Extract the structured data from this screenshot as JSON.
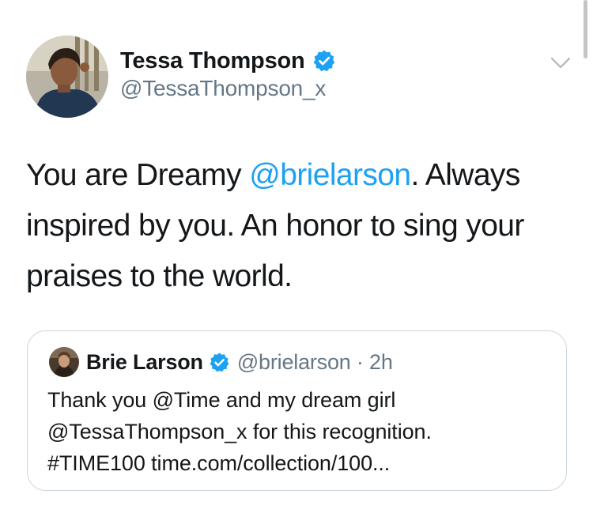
{
  "tweet": {
    "author": {
      "display_name": "Tessa Thompson",
      "handle": "@TessaThompson_x",
      "verified": true,
      "avatar_icon": "profile-photo"
    },
    "menu_icon": "chevron-down-icon",
    "text": {
      "part1": "You are Dreamy ",
      "mention": "@brielarson",
      "part2": ". Always inspired by you. An honor to sing your praises to the world."
    },
    "quoted_tweet": {
      "display_name": "Brie Larson",
      "verified": true,
      "meta": "@brielarson · 2h",
      "text": {
        "line1": "Thank you @Time and my dream girl",
        "line2": "@TessaThompson_x for this recognition.",
        "line3": "#TIME100 time.com/collection/100..."
      }
    }
  },
  "colors": {
    "link": "#1da1f2",
    "secondary_text": "#657786",
    "border": "#ccd6dd",
    "verified_badge": "#1da1f2"
  }
}
